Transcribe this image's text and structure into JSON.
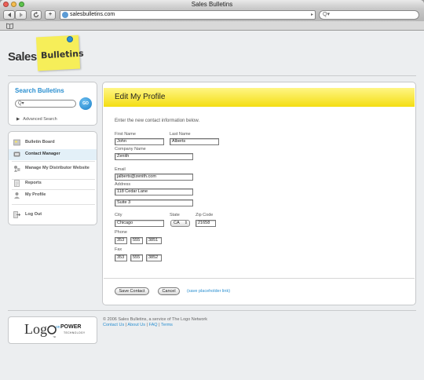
{
  "browser": {
    "title": "Sales Bulletins",
    "url": "salesbulletins.com",
    "back_icon": "back-arrow-icon",
    "forward_icon": "forward-arrow-icon",
    "reload_icon": "reload-icon",
    "add_label": "+",
    "search_placeholder": "Q▾"
  },
  "brand": {
    "sales": "Sales",
    "bulletins": "Bulletins",
    "sticky_color": "#f6ee59",
    "accent": "#2a8fd0"
  },
  "sidebar": {
    "search_title": "Search Bulletins",
    "search_placeholder": "Q▾",
    "go_label": "GO",
    "advanced_label": "Advanced Search",
    "nav": [
      {
        "label": "Bulletin Board",
        "icon": "bulletin-board-icon"
      },
      {
        "label": "Contact Manager",
        "icon": "contact-manager-icon"
      },
      {
        "label": "Manage My Distributor Website",
        "icon": "distributor-website-icon"
      },
      {
        "label": "Reports",
        "icon": "reports-icon"
      },
      {
        "label": "My Profile",
        "icon": "profile-icon"
      },
      {
        "label": "Log Out",
        "icon": "logout-icon"
      }
    ]
  },
  "main": {
    "title": "Edit My Profile",
    "intro": "Enter the new contact information below.",
    "labels": {
      "first_name": "First Name",
      "last_name": "Last Name",
      "company": "Company Name",
      "email": "Email",
      "address": "Address",
      "city": "City",
      "state": "State",
      "zip": "Zip Code",
      "phone": "Phone",
      "fax": "Fax"
    },
    "values": {
      "first_name": "John",
      "last_name": "Alberts",
      "company": "Zenith",
      "email": "jalberts@zenith.com",
      "address1": "118 Cedar Lane",
      "address2": "Suite 3",
      "city": "Chicago",
      "state": "CA",
      "zip": "21658",
      "phone": [
        "353",
        "555",
        "3851"
      ],
      "fax": [
        "353",
        "555",
        "3852"
      ]
    },
    "save_label": "Save Contact",
    "cancel_label": "Cancel",
    "placeholder_link": "(save placeholder link)"
  },
  "footer": {
    "copyright": "© 2006 Sales Bulletins, a service of The Logo Network",
    "links": [
      "Contact Us",
      "About Us",
      "FAQ",
      "Terms"
    ],
    "logo_on": "on",
    "logo_power": "POWER",
    "logo_tech": "TECHNOLOGY"
  }
}
